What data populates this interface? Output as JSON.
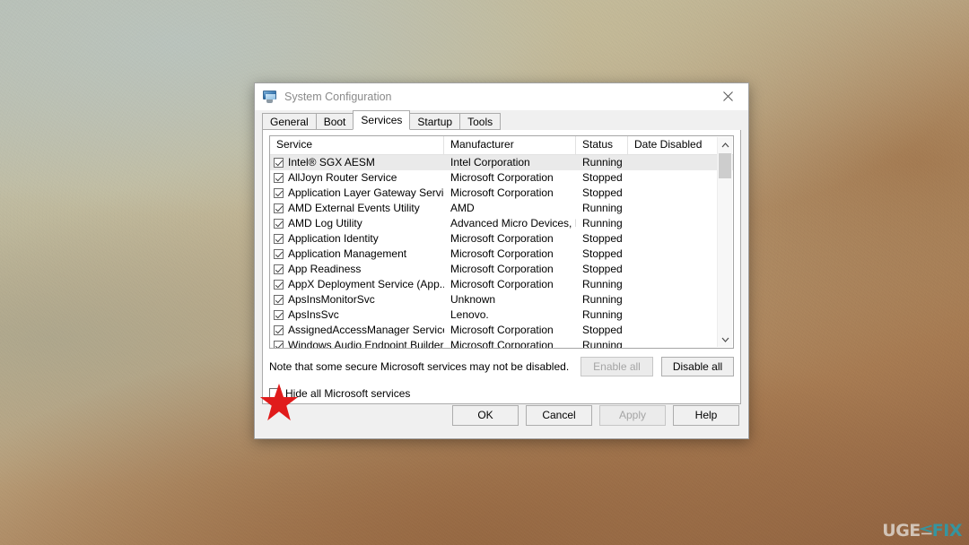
{
  "window": {
    "title": "System Configuration",
    "icon": "computer-monitor-icon",
    "close_label": "✕"
  },
  "tabs": [
    {
      "label": "General",
      "active": false
    },
    {
      "label": "Boot",
      "active": false
    },
    {
      "label": "Services",
      "active": true
    },
    {
      "label": "Startup",
      "active": false
    },
    {
      "label": "Tools",
      "active": false
    }
  ],
  "services_table": {
    "columns": [
      "Service",
      "Manufacturer",
      "Status",
      "Date Disabled"
    ],
    "rows": [
      {
        "checked": true,
        "service": "Intel® SGX AESM",
        "manufacturer": "Intel Corporation",
        "status": "Running",
        "date_disabled": "",
        "selected": true
      },
      {
        "checked": true,
        "service": "AllJoyn Router Service",
        "manufacturer": "Microsoft Corporation",
        "status": "Stopped",
        "date_disabled": "",
        "selected": false
      },
      {
        "checked": true,
        "service": "Application Layer Gateway Service",
        "manufacturer": "Microsoft Corporation",
        "status": "Stopped",
        "date_disabled": "",
        "selected": false
      },
      {
        "checked": true,
        "service": "AMD External Events Utility",
        "manufacturer": "AMD",
        "status": "Running",
        "date_disabled": "",
        "selected": false
      },
      {
        "checked": true,
        "service": "AMD Log Utility",
        "manufacturer": "Advanced Micro Devices, I...",
        "status": "Running",
        "date_disabled": "",
        "selected": false
      },
      {
        "checked": true,
        "service": "Application Identity",
        "manufacturer": "Microsoft Corporation",
        "status": "Stopped",
        "date_disabled": "",
        "selected": false
      },
      {
        "checked": true,
        "service": "Application Management",
        "manufacturer": "Microsoft Corporation",
        "status": "Stopped",
        "date_disabled": "",
        "selected": false
      },
      {
        "checked": true,
        "service": "App Readiness",
        "manufacturer": "Microsoft Corporation",
        "status": "Stopped",
        "date_disabled": "",
        "selected": false
      },
      {
        "checked": true,
        "service": "AppX Deployment Service (App...",
        "manufacturer": "Microsoft Corporation",
        "status": "Running",
        "date_disabled": "",
        "selected": false
      },
      {
        "checked": true,
        "service": "ApsInsMonitorSvc",
        "manufacturer": "Unknown",
        "status": "Running",
        "date_disabled": "",
        "selected": false
      },
      {
        "checked": true,
        "service": "ApsInsSvc",
        "manufacturer": "Lenovo.",
        "status": "Running",
        "date_disabled": "",
        "selected": false
      },
      {
        "checked": true,
        "service": "AssignedAccessManager Service",
        "manufacturer": "Microsoft Corporation",
        "status": "Stopped",
        "date_disabled": "",
        "selected": false
      },
      {
        "checked": true,
        "service": "Windows Audio Endpoint Builder",
        "manufacturer": "Microsoft Corporation",
        "status": "Running",
        "date_disabled": "",
        "selected": false
      }
    ]
  },
  "note": "Note that some secure Microsoft services may not be disabled.",
  "buttons": {
    "enable_all": "Enable all",
    "enable_all_disabled": true,
    "disable_all": "Disable all",
    "ok": "OK",
    "cancel": "Cancel",
    "apply": "Apply",
    "apply_disabled": true,
    "help": "Help"
  },
  "hide_microsoft": {
    "label": "Hide all Microsoft services",
    "checked": false
  },
  "annotation": {
    "marker": "red-star",
    "color": "#e01b1b"
  },
  "watermark": {
    "part1": "UGE",
    "part2": "FIX",
    "color_light": "#d8cdc2",
    "color_teal": "#2e9aa8"
  }
}
